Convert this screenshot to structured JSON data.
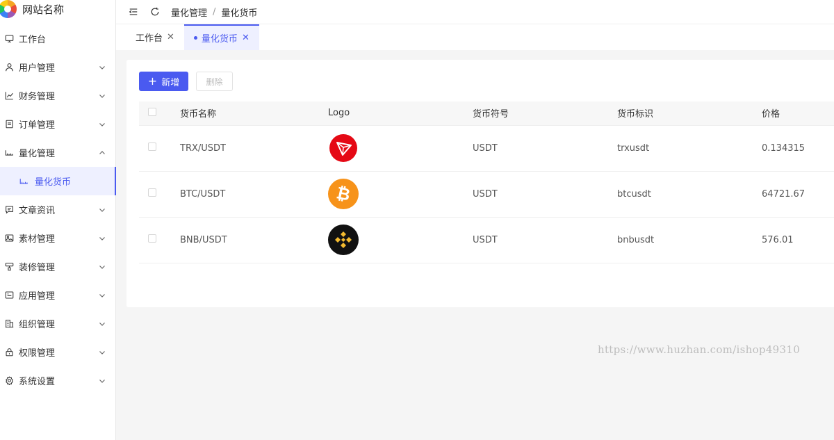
{
  "brand": {
    "name": "网站名称"
  },
  "sidebar": {
    "items": [
      {
        "label": "工作台",
        "icon": "monitor-icon",
        "expandable": false
      },
      {
        "label": "用户管理",
        "icon": "user-icon",
        "expandable": true
      },
      {
        "label": "财务管理",
        "icon": "chart-icon",
        "expandable": true
      },
      {
        "label": "订单管理",
        "icon": "document-icon",
        "expandable": true
      },
      {
        "label": "量化管理",
        "icon": "quant-icon",
        "expandable": true,
        "expanded": true
      },
      {
        "label": "文章资讯",
        "icon": "message-icon",
        "expandable": true
      },
      {
        "label": "素材管理",
        "icon": "image-icon",
        "expandable": true
      },
      {
        "label": "装修管理",
        "icon": "brush-icon",
        "expandable": true
      },
      {
        "label": "应用管理",
        "icon": "app-icon",
        "expandable": true
      },
      {
        "label": "组织管理",
        "icon": "building-icon",
        "expandable": true
      },
      {
        "label": "权限管理",
        "icon": "lock-icon",
        "expandable": true
      },
      {
        "label": "系统设置",
        "icon": "gear-icon",
        "expandable": true
      }
    ],
    "subitem": {
      "label": "量化货币",
      "icon": "quant-icon"
    }
  },
  "topbar": {
    "breadcrumb": [
      "量化管理",
      "量化货币"
    ],
    "separator": "/"
  },
  "tabs": [
    {
      "label": "工作台",
      "active": false
    },
    {
      "label": "量化货币",
      "active": true
    }
  ],
  "toolbar": {
    "add_label": "新增",
    "delete_label": "删除"
  },
  "table": {
    "headers": [
      "货币名称",
      "Logo",
      "货币符号",
      "货币标识",
      "价格"
    ],
    "rows": [
      {
        "name": "TRX/USDT",
        "logo": "tron-logo",
        "symbol": "USDT",
        "tag": "trxusdt",
        "price": "0.134315"
      },
      {
        "name": "BTC/USDT",
        "logo": "bitcoin-logo",
        "symbol": "USDT",
        "tag": "btcusdt",
        "price": "64721.67"
      },
      {
        "name": "BNB/USDT",
        "logo": "bnb-logo",
        "symbol": "USDT",
        "tag": "bnbusdt",
        "price": "576.01"
      }
    ]
  },
  "colors": {
    "accent": "#4a5af0",
    "tron": "#e50915",
    "bitcoin": "#f7931a",
    "bnb": "#f3ba2f"
  },
  "watermark": "https://www.huzhan.com/ishop49310"
}
